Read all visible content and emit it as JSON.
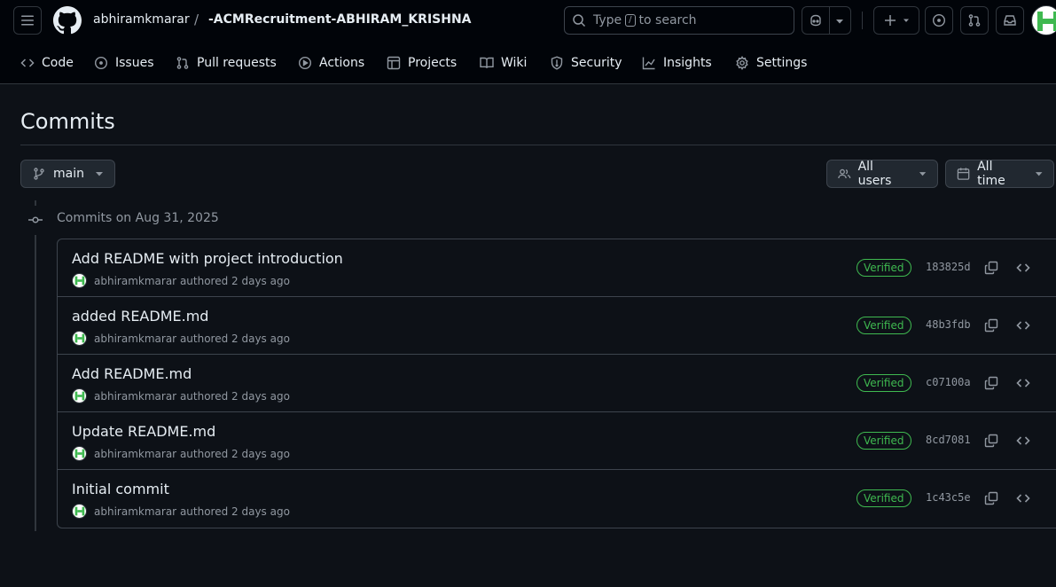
{
  "header": {
    "owner": "abhiramkmarar",
    "separator": "/",
    "repo": "-ACMRecruitment-ABHIRAM_KRISHNA",
    "search_prefix": "Type",
    "search_key": "/",
    "search_suffix": "to search"
  },
  "nav": {
    "items": [
      {
        "label": "Code",
        "icon": "code-icon"
      },
      {
        "label": "Issues",
        "icon": "issue-icon"
      },
      {
        "label": "Pull requests",
        "icon": "pull-request-icon"
      },
      {
        "label": "Actions",
        "icon": "play-icon"
      },
      {
        "label": "Projects",
        "icon": "table-icon"
      },
      {
        "label": "Wiki",
        "icon": "book-icon"
      },
      {
        "label": "Security",
        "icon": "shield-icon"
      },
      {
        "label": "Insights",
        "icon": "graph-icon"
      },
      {
        "label": "Settings",
        "icon": "gear-icon"
      }
    ]
  },
  "page": {
    "title": "Commits",
    "branch": "main",
    "users_filter": "All users",
    "time_filter": "All time",
    "group_label": "Commits on Aug 31, 2025"
  },
  "commits": [
    {
      "message": "Add README with project introduction",
      "author": "abhiramkmarar",
      "meta": "authored 2 days ago",
      "badge": "Verified",
      "sha": "183825d"
    },
    {
      "message": "added README.md",
      "author": "abhiramkmarar",
      "meta": "authored 2 days ago",
      "badge": "Verified",
      "sha": "48b3fdb"
    },
    {
      "message": "Add README.md",
      "author": "abhiramkmarar",
      "meta": "authored 2 days ago",
      "badge": "Verified",
      "sha": "c07100a"
    },
    {
      "message": "Update README.md",
      "author": "abhiramkmarar",
      "meta": "authored 2 days ago",
      "badge": "Verified",
      "sha": "8cd7081"
    },
    {
      "message": "Initial commit",
      "author": "abhiramkmarar",
      "meta": "authored 2 days ago",
      "badge": "Verified",
      "sha": "1c43c5e"
    }
  ],
  "colors": {
    "background": "#0d1117",
    "header": "#010409",
    "border": "#30363d",
    "text": "#e6edf3",
    "muted": "#9198a1",
    "verified": "#3fb950",
    "avatar_accent": "#3fb950"
  }
}
